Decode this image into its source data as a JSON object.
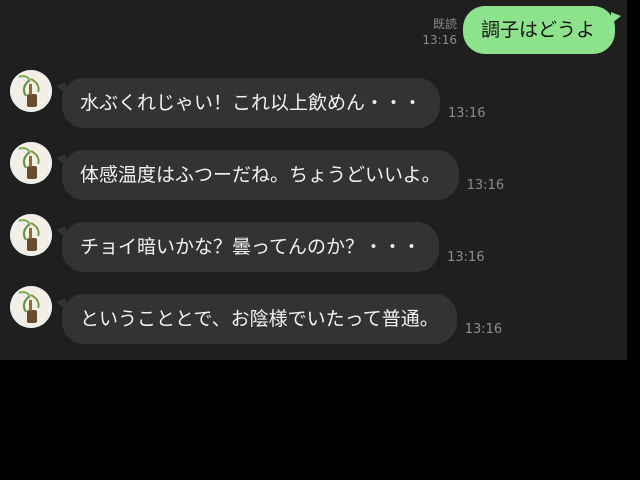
{
  "sent_message": {
    "read_label": "既読",
    "time": "13:16",
    "text": "調子はどうよ"
  },
  "received_messages": [
    {
      "text": "水ぶくれじゃい！これ以上飲めん・・・",
      "time": "13:16",
      "avatar_icon": "plant-avatar-icon"
    },
    {
      "text": "体感温度はふつーだね。ちょうどいいよ。",
      "time": "13:16",
      "avatar_icon": "plant-avatar-icon"
    },
    {
      "text": "チョイ暗いかな？曇ってんのか？・・・",
      "time": "13:16",
      "avatar_icon": "plant-avatar-icon"
    },
    {
      "text": "ということとで、お陰様でいたって普通。",
      "time": "13:16",
      "avatar_icon": "plant-avatar-icon"
    }
  ],
  "colors": {
    "chat_background": "#1f1f1f",
    "page_background": "#000000",
    "sent_bubble": "#8de38c",
    "received_bubble": "#333333",
    "meta_text": "#8c8c8c"
  }
}
